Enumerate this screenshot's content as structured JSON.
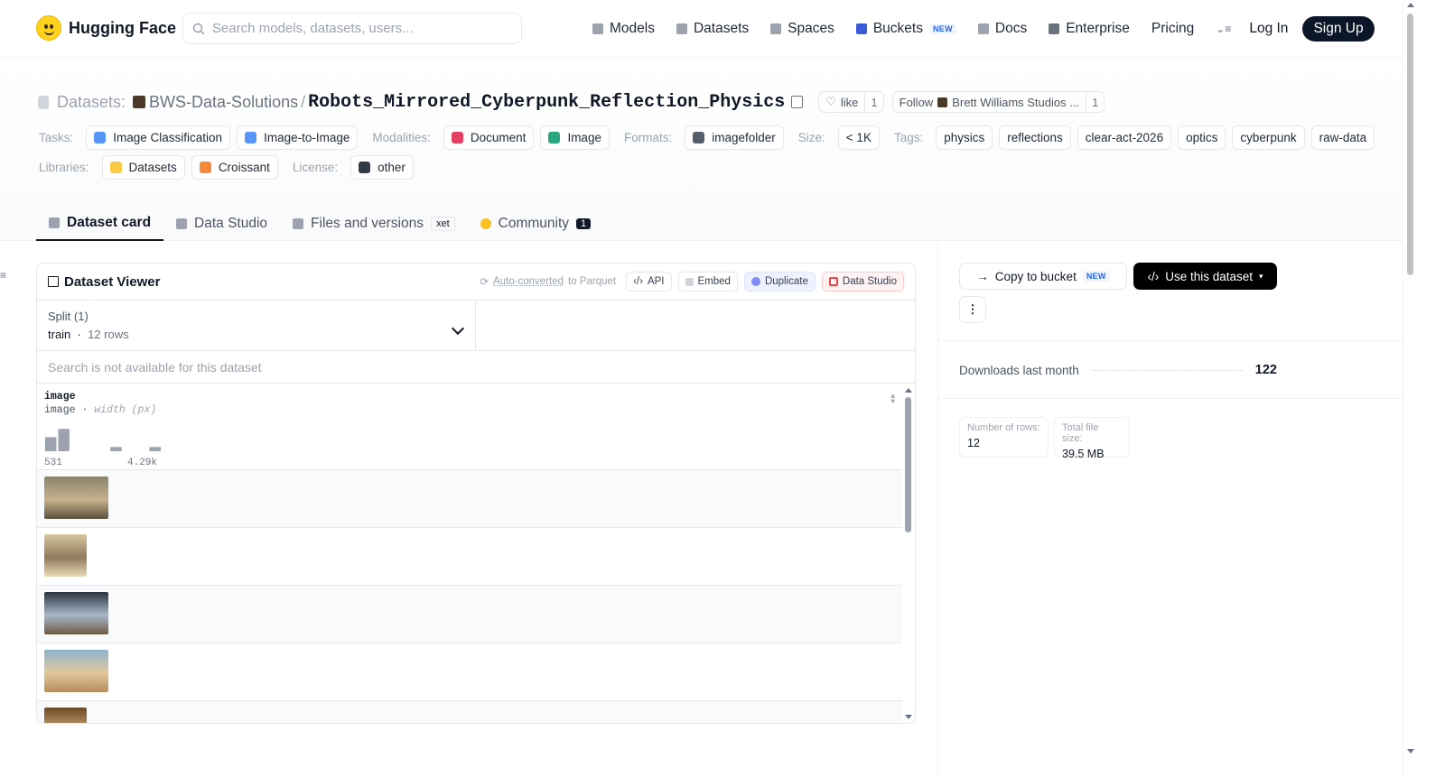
{
  "nav": {
    "brand": "Hugging Face",
    "search_placeholder": "Search models, datasets, users...",
    "links": [
      {
        "label": "Models",
        "icon": "cube-icon",
        "color": "#9ca3af"
      },
      {
        "label": "Datasets",
        "icon": "database-icon",
        "color": "#9ca3af"
      },
      {
        "label": "Spaces",
        "icon": "grid-icon",
        "color": "#9ca3af"
      },
      {
        "label": "Buckets",
        "icon": "bucket-icon",
        "color": "#3b5bdb",
        "badge": "NEW"
      },
      {
        "label": "Docs",
        "icon": "book-icon",
        "color": "#9ca3af"
      },
      {
        "label": "Enterprise",
        "icon": "enterprise-icon",
        "color": "#6b7280"
      },
      {
        "label": "Pricing"
      }
    ],
    "login": "Log In",
    "signup": "Sign Up"
  },
  "header": {
    "crumb_label": "Datasets:",
    "org": "BWS-Data-Solutions",
    "separator": "/",
    "repo": "Robots_Mirrored_Cyberpunk_Reflection_Physics",
    "like_label": "like",
    "like_count": "1",
    "follow_label": "Follow",
    "follow_name": "Brett Williams Studios ...",
    "follow_count": "1"
  },
  "tags": {
    "tasks_label": "Tasks:",
    "tasks": [
      {
        "label": "Image Classification",
        "color": "#3b82f6"
      },
      {
        "label": "Image-to-Image",
        "color": "#3b82f6"
      }
    ],
    "modalities_label": "Modalities:",
    "modalities": [
      {
        "label": "Document",
        "color": "#e11d48"
      },
      {
        "label": "Image",
        "color": "#059669"
      }
    ],
    "formats_label": "Formats:",
    "formats": [
      {
        "label": "imagefolder",
        "color": "#374151"
      }
    ],
    "size_label": "Size:",
    "size": "< 1K",
    "tags_label": "Tags:",
    "tags": [
      "physics",
      "reflections",
      "clear-act-2026",
      "optics",
      "cyberpunk",
      "raw-data"
    ],
    "libraries_label": "Libraries:",
    "libraries": [
      {
        "label": "Datasets",
        "color": "#fbbf24"
      },
      {
        "label": "Croissant",
        "color": "#f97316"
      }
    ],
    "license_label": "License:",
    "license": "other"
  },
  "tabs": [
    {
      "label": "Dataset card",
      "active": true
    },
    {
      "label": "Data Studio"
    },
    {
      "label": "Files and versions",
      "badge": "xet"
    },
    {
      "label": "Community",
      "count": "1"
    }
  ],
  "viewer": {
    "title": "Dataset Viewer",
    "auto_converted": "Auto-converted",
    "auto_suffix": "to Parquet",
    "btn_api": "API",
    "btn_embed": "Embed",
    "btn_duplicate": "Duplicate",
    "btn_datastudio": "Data Studio",
    "split_label": "Split (1)",
    "split_name": "train",
    "split_rows": "12 rows",
    "search_na": "Search is not available for this dataset",
    "column_name": "image",
    "column_type": "image",
    "column_sub": "width (px)",
    "hist_min": "531",
    "hist_max": "4.29k",
    "histogram": [
      0.6,
      0.95,
      0,
      0,
      0,
      0.18,
      0,
      0,
      0.18
    ],
    "rows": [
      {
        "kind": "wide",
        "colors": [
          "#8a8370",
          "#c7b28c",
          "#5a4e3c"
        ]
      },
      {
        "kind": "square",
        "colors": [
          "#d8c7a1",
          "#8e7a5c",
          "#e9d9b4"
        ]
      },
      {
        "kind": "wide",
        "colors": [
          "#2b3441",
          "#a8b7c9",
          "#6c5a45"
        ]
      },
      {
        "kind": "wide",
        "colors": [
          "#90b3cf",
          "#e2c79a",
          "#b78d5c"
        ]
      },
      {
        "kind": "square",
        "colors": [
          "#6b4a2a",
          "#c9a26a",
          "#a9c3dc"
        ]
      }
    ]
  },
  "sidebar": {
    "copy_bucket": "Copy to bucket",
    "copy_badge": "NEW",
    "use_dataset": "Use this dataset",
    "more": "⋮",
    "downloads_label": "Downloads last month",
    "downloads_value": "122",
    "rows_label": "Number of rows:",
    "rows_value": "12",
    "size_label": "Total file size:",
    "size_value": "39.5 MB"
  }
}
